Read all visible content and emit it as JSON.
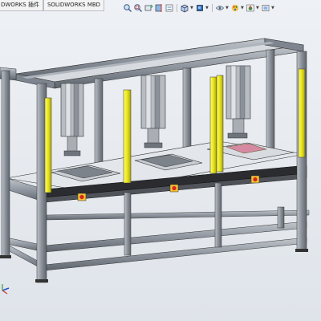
{
  "app": {
    "tabs": [
      {
        "label": "DWORKS 插件"
      },
      {
        "label": "SOLIDWORKS MBD"
      }
    ]
  },
  "heads_up_toolbar": {
    "items": [
      {
        "icon": "zoom-to-fit-icon"
      },
      {
        "icon": "zoom-to-area-icon"
      },
      {
        "icon": "previous-view-icon"
      },
      {
        "icon": "section-view-icon"
      },
      {
        "icon": "dynamic-annotation-icon"
      },
      {
        "icon": "view-orientation-icon"
      },
      {
        "icon": "display-style-icon"
      },
      {
        "icon": "hide-show-items-icon"
      },
      {
        "icon": "edit-appearance-icon"
      },
      {
        "icon": "apply-scene-icon"
      },
      {
        "icon": "view-settings-icon"
      }
    ]
  },
  "model": {
    "frame_color": "#9aa1aa",
    "light_curtain_color": "#e6e21b",
    "background_top": "#eef1f5",
    "background_bottom": "#dfe4ea"
  }
}
